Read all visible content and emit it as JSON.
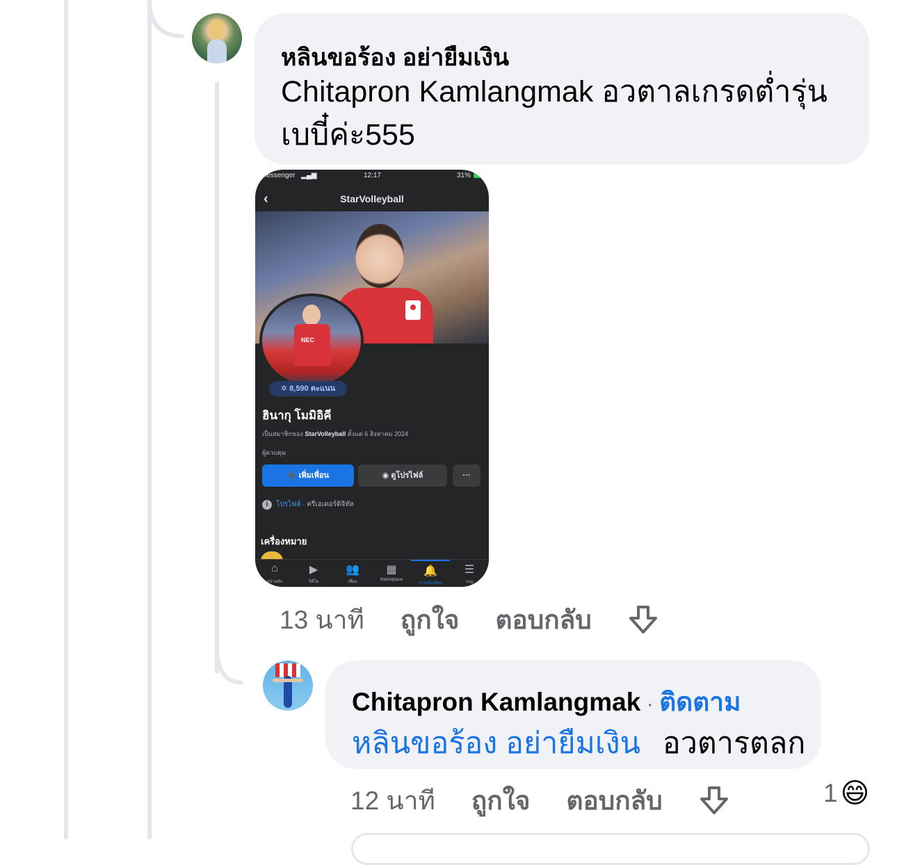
{
  "comment1": {
    "author": "หลินขอร้อง อย่ายืมเงิน",
    "text_line1": "Chitapron Kamlangmak อวตาลเกรดต่ำรุ่น",
    "text_line2": "เบบี๋ค่ะ555",
    "time": "13 นาที",
    "like_label": "ถูกใจ",
    "reply_label": "ตอบกลับ"
  },
  "attachment": {
    "status_left": "Messenger",
    "status_time": "12:17",
    "status_right": "31%",
    "header_title": "StarVolleyball",
    "points": "8,590 คะแนน",
    "name": "ฮินากุ โมมิอิคี",
    "member_prefix": "เป็นสมาชิกของ",
    "member_group": "StarVolleyball",
    "member_suffix": "ตั้งแต่ 6 สิงหาคม  2024",
    "role": "ผู้ควบคุม",
    "add_friend": "เพิ่มเพื่อน",
    "view_profile": "ดูโปรไฟล์",
    "more": "···",
    "info_link": "โปรไฟล์",
    "info_rest": " · ครีเอเตอร์ดิจิทัล",
    "section_title": "เครื่องหมาย",
    "nav": [
      {
        "icon": "home-icon",
        "glyph": "⌂",
        "label": "หน้าหลัก"
      },
      {
        "icon": "video-icon",
        "glyph": "▶",
        "label": "วิดีโอ"
      },
      {
        "icon": "friends-icon",
        "glyph": "👥",
        "label": "เพื่อน"
      },
      {
        "icon": "marketplace-icon",
        "glyph": "▦",
        "label": "Marketplace"
      },
      {
        "icon": "bell-icon",
        "glyph": "🔔",
        "label": "การแจ้งเตือน"
      },
      {
        "icon": "menu-icon",
        "glyph": "☰",
        "label": "เมนู"
      }
    ]
  },
  "comment2": {
    "author": "Chitapron Kamlangmak",
    "separator": "·",
    "follow_label": "ติดตาม",
    "mention": "หลินขอร้อง อย่ายืมเงิน",
    "text": "อวตารตลก",
    "time": "12 นาที",
    "like_label": "ถูกใจ",
    "reply_label": "ตอบกลับ",
    "reaction_count": "1",
    "reaction_emoji": "😄"
  },
  "colors": {
    "bubble": "#f0f2f5",
    "link": "#1b74e4",
    "secondary_text": "#65676b",
    "thread_line": "#e4e6eb"
  }
}
